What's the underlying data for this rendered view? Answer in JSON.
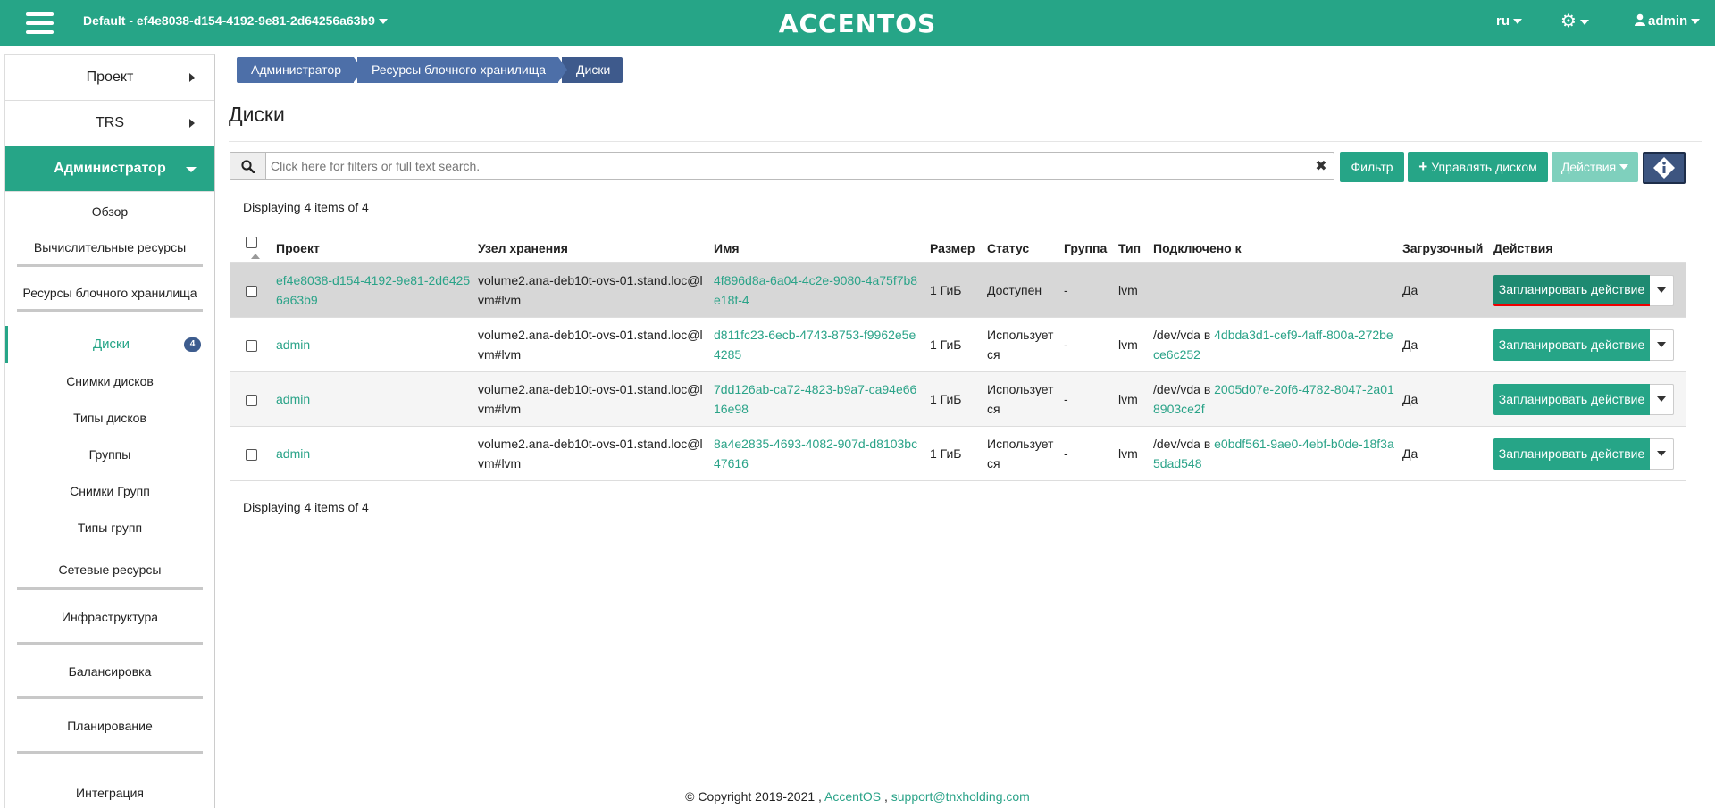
{
  "header": {
    "project_selector": "Default - ef4e8038-d154-4192-9e81-2d64256a63b9",
    "logo": "ACCENTOS",
    "language": "ru",
    "user": "admin"
  },
  "sidebar": {
    "panels": [
      {
        "label": "Проект"
      },
      {
        "label": "TRS"
      },
      {
        "label": "Администратор"
      }
    ],
    "items": [
      {
        "label": "Обзор"
      },
      {
        "label": "Вычислительные ресурсы"
      },
      {
        "label": "Ресурсы блочного хранилища"
      },
      {
        "label": "Диски",
        "badge": "4"
      },
      {
        "label": "Снимки дисков"
      },
      {
        "label": "Типы дисков"
      },
      {
        "label": "Группы"
      },
      {
        "label": "Снимки Групп"
      },
      {
        "label": "Типы групп"
      },
      {
        "label": "Сетевые ресурсы"
      },
      {
        "label": "Инфраструктура"
      },
      {
        "label": "Балансировка"
      },
      {
        "label": "Планирование"
      },
      {
        "label": "Интеграция"
      }
    ]
  },
  "breadcrumb": [
    "Администратор",
    "Ресурсы блочного хранилища",
    "Диски"
  ],
  "page": {
    "title": "Диски",
    "search_placeholder": "Click here for filters or full text search.",
    "filter_button": "Фильтр",
    "manage_button": "Управлять диском",
    "actions_button": "Действия",
    "displaying_top": "Displaying 4 items of 4",
    "displaying_bottom": "Displaying 4 items of 4"
  },
  "table": {
    "columns": [
      "Проект",
      "Узел хранения",
      "Имя",
      "Размер",
      "Статус",
      "Группа",
      "Тип",
      "Подключено к",
      "Загрузочный",
      "Действия"
    ],
    "rows": [
      {
        "project": "ef4e8038-d154-4192-9e81-2d64256a63b9",
        "host": "volume2.ana-deb10t-ovs-01.stand.loc@lvm#lvm",
        "name": "4f896d8a-6a04-4c2e-9080-4a75f7b8e18f-4",
        "size": "1 ГиБ",
        "status": "Доступен",
        "group": "-",
        "type": "lvm",
        "attached_prefix": "",
        "attached_link": "",
        "bootable": "Да",
        "action": "Запланировать действие"
      },
      {
        "project": "admin",
        "host": "volume2.ana-deb10t-ovs-01.stand.loc@lvm#lvm",
        "name": "d811fc23-6ecb-4743-8753-f9962e5e4285",
        "size": "1 ГиБ",
        "status": "Используется",
        "group": "-",
        "type": "lvm",
        "attached_prefix": "/dev/vda в ",
        "attached_link": "4dbda3d1-cef9-4aff-800a-272bece6c252",
        "bootable": "Да",
        "action": "Запланировать действие"
      },
      {
        "project": "admin",
        "host": "volume2.ana-deb10t-ovs-01.stand.loc@lvm#lvm",
        "name": "7dd126ab-ca72-4823-b9a7-ca94e6616e98",
        "size": "1 ГиБ",
        "status": "Используется",
        "group": "-",
        "type": "lvm",
        "attached_prefix": "/dev/vda в ",
        "attached_link": "2005d07e-20f6-4782-8047-2a018903ce2f",
        "bootable": "Да",
        "action": "Запланировать действие"
      },
      {
        "project": "admin",
        "host": "volume2.ana-deb10t-ovs-01.stand.loc@lvm#lvm",
        "name": "8a4e2835-4693-4082-907d-d8103bc47616",
        "size": "1 ГиБ",
        "status": "Используется",
        "group": "-",
        "type": "lvm",
        "attached_prefix": "/dev/vda в ",
        "attached_link": "e0bdf561-9ae0-4ebf-b0de-18f3a5dad548",
        "bootable": "Да",
        "action": "Запланировать действие"
      }
    ]
  },
  "footer": {
    "copyright": "© Copyright 2019-2021 ,",
    "brand_link": "AccentOS",
    "separator": ",",
    "support_link": "support@tnxholding.com"
  },
  "colors": {
    "accent": "#26a587",
    "breadcrumb": "#4d6fa8",
    "badge": "#3d5c8e"
  }
}
